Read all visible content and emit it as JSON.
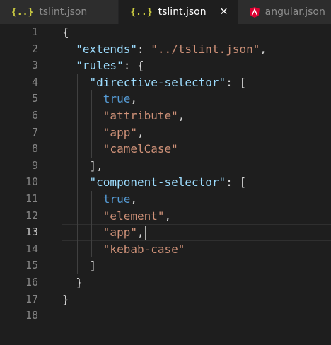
{
  "tabs": [
    {
      "icon": "json-braces-icon",
      "label": "tslint.json",
      "active": false
    },
    {
      "icon": "json-braces-icon",
      "label": "tslint.json",
      "active": true
    },
    {
      "icon": "angular-icon",
      "label": "angular.json",
      "active": false
    }
  ],
  "json_icon_glyph": "{..}",
  "close_glyph": "✕",
  "colors": {
    "key": "#9cdcfe",
    "string": "#ce9178",
    "boolean": "#569cd6",
    "punctuation": "#d4d4d4",
    "angular": "#dd0031"
  },
  "editor": {
    "current_line": 13,
    "lines": [
      {
        "n": "1",
        "t": [
          "{"
        ]
      },
      {
        "n": "2",
        "t": [
          "  ",
          "\"extends\"",
          ": ",
          "\"../tslint.json\"",
          ","
        ]
      },
      {
        "n": "3",
        "t": [
          "  ",
          "\"rules\"",
          ": {"
        ]
      },
      {
        "n": "4",
        "t": [
          "    ",
          "\"directive-selector\"",
          ": ["
        ]
      },
      {
        "n": "5",
        "t": [
          "      ",
          "true",
          ","
        ]
      },
      {
        "n": "6",
        "t": [
          "      ",
          "\"attribute\"",
          ","
        ]
      },
      {
        "n": "7",
        "t": [
          "      ",
          "\"app\"",
          ","
        ]
      },
      {
        "n": "8",
        "t": [
          "      ",
          "\"camelCase\""
        ]
      },
      {
        "n": "9",
        "t": [
          "    ],"
        ]
      },
      {
        "n": "10",
        "t": [
          "    ",
          "\"component-selector\"",
          ": ["
        ]
      },
      {
        "n": "11",
        "t": [
          "      ",
          "true",
          ","
        ]
      },
      {
        "n": "12",
        "t": [
          "      ",
          "\"element\"",
          ","
        ]
      },
      {
        "n": "13",
        "t": [
          "      ",
          "\"app\"",
          ","
        ]
      },
      {
        "n": "14",
        "t": [
          "      ",
          "\"kebab-case\""
        ]
      },
      {
        "n": "15",
        "t": [
          "    ]"
        ]
      },
      {
        "n": "16",
        "t": [
          "  }"
        ]
      },
      {
        "n": "17",
        "t": [
          "}"
        ]
      },
      {
        "n": "18",
        "t": [
          ""
        ]
      }
    ]
  }
}
